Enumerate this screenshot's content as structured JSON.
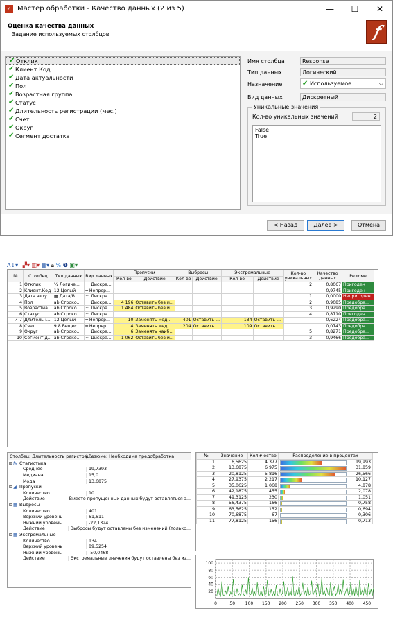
{
  "dialog": {
    "title": "Мастер обработки - Качество данных (2 из 5)",
    "heading": "Оценка качества данных",
    "subheading": "Задание используемых столбцов",
    "win_min": "—",
    "win_max": "☐",
    "win_close": "✕"
  },
  "columns": [
    "Отклик",
    "Клиент.Код",
    "Дата актуальности",
    "Пол",
    "Возрастная группа",
    "Статус",
    "Длительность регистрации (мес.)",
    "Счет",
    "Округ",
    "Сегмент достатка"
  ],
  "props": {
    "name_label": "Имя столбца",
    "name": "Response",
    "type_label": "Тип данных",
    "type": "Логический",
    "usage_label": "Назначение",
    "usage": "Используемое",
    "kind_label": "Вид данных",
    "kind": "Дискретный",
    "group_label": "Уникальные значения",
    "count_label": "Кол-во уникальных значений",
    "count": "2",
    "values": [
      "False",
      "True"
    ]
  },
  "buttons": {
    "back": "< Назад",
    "next": "Далее >",
    "cancel": "Отмена"
  },
  "grid": {
    "headers": {
      "num": "№",
      "col": "Столбец",
      "type": "Тип данных",
      "kind": "Вид данных",
      "gaps": "Пропуски",
      "outliers": "Выбросы",
      "extremes": "Экстремальные",
      "count": "Кол-во",
      "action": "Действие",
      "unique": "Кол-во уникальных",
      "quality": "Качество данных",
      "resume": "Резюме"
    },
    "rows": [
      [
        "1",
        "Отклик",
        "⁰⁄₁ Логиче...",
        "··· Дискре...",
        "",
        "",
        "",
        "",
        "",
        "",
        "2",
        "0,8067",
        "Пригоден",
        "ok"
      ],
      [
        "2",
        "Клиент.Код",
        "12 Целый",
        "━ Непрер...",
        "",
        "",
        "",
        "",
        "",
        "",
        "",
        "0,9745",
        "Пригоден",
        "ok"
      ],
      [
        "3",
        "Дата акту...",
        "▦ Дата/В...",
        "··· Дискре...",
        "",
        "",
        "",
        "",
        "",
        "",
        "1",
        "0,0000",
        "Непригоден",
        "bad"
      ],
      [
        "4",
        "Пол",
        "ab Строко...",
        "··· Дискре...",
        "4 196",
        "Оставить без и...",
        "",
        "",
        "",
        "",
        "2",
        "0,9085",
        "Предобра...",
        "pre"
      ],
      [
        "5",
        "Возрастна...",
        "ab Строко...",
        "··· Дискре...",
        "1 484",
        "Оставить без и...",
        "",
        "",
        "",
        "",
        "3",
        "0,9290",
        "Предобра...",
        "pre"
      ],
      [
        "6",
        "Статус",
        "ab Строко...",
        "··· Дискре...",
        "",
        "",
        "",
        "",
        "",
        "",
        "4",
        "0,8710",
        "Пригоден",
        "ok"
      ],
      [
        "7",
        "Длительн...",
        "12 Целый",
        "━ Непрер...",
        "10",
        "Заменять мед...",
        "401",
        "Оставить ...",
        "134",
        "Оставить ...",
        "",
        "0,6224",
        "Предобра...",
        "pre"
      ],
      [
        "8",
        "Счет",
        "9.8 Вещест...",
        "━ Непрер...",
        "4",
        "Заменять мед...",
        "204",
        "Оставить ...",
        "109",
        "Оставить ...",
        "",
        "0,0743",
        "Предобра...",
        "pre"
      ],
      [
        "9",
        "Округ",
        "ab Строко...",
        "··· Дискре...",
        "6",
        "Заменять наиб...",
        "",
        "",
        "",
        "",
        "5",
        "0,8271",
        "Предобра...",
        "pre"
      ],
      [
        "10",
        "Сегмент д...",
        "ab Строко...",
        "··· Дискре...",
        "1 062",
        "Оставить без и...",
        "",
        "",
        "",
        "",
        "3",
        "0,9466",
        "Предобра...",
        "pre"
      ]
    ]
  },
  "stats": {
    "col_header": "Столбец: Длительность регистрац...",
    "resume_header": "Резюме: Необходима предобработка",
    "rows": [
      [
        "g",
        "fx",
        "Статистика",
        ""
      ],
      [
        "i",
        "",
        "Среднее",
        "19,7393"
      ],
      [
        "i",
        "",
        "Медиана",
        "15,0"
      ],
      [
        "i",
        "",
        "Мода",
        "13,6875"
      ],
      [
        "g",
        "◢",
        "Пропуски",
        ""
      ],
      [
        "i",
        "",
        "Количество",
        "10"
      ],
      [
        "i",
        "",
        "Действие",
        "Вместо пропущенных данных будут вставляться з..."
      ],
      [
        "g",
        "▦",
        "Выбросы",
        ""
      ],
      [
        "i",
        "",
        "Количество",
        "401"
      ],
      [
        "i",
        "",
        "Верхний уровень",
        "61,611"
      ],
      [
        "i",
        "",
        "Нижний уровень",
        "-22,1324"
      ],
      [
        "i",
        "",
        "Действие",
        "Выбросы будут оставлены без изменений (только..."
      ],
      [
        "g",
        "▦",
        "Экстремальные",
        ""
      ],
      [
        "i",
        "",
        "Количество",
        "134"
      ],
      [
        "i",
        "",
        "Верхний уровень",
        "89,5254"
      ],
      [
        "i",
        "",
        "Нижний уровень",
        "-50,0468"
      ],
      [
        "i",
        "",
        "Действие",
        "Экстремальные значения будут оставлены без из..."
      ]
    ]
  },
  "dist": {
    "headers": [
      "№",
      "Значение",
      "Количество",
      "Распределение в процентах"
    ],
    "rows": [
      [
        "1",
        "6,5625",
        "4 377",
        "19,993",
        19.993
      ],
      [
        "2",
        "13,6875",
        "6 975",
        "31,859",
        31.859
      ],
      [
        "3",
        "20,8125",
        "5 816",
        "26,566",
        26.566
      ],
      [
        "4",
        "27,9375",
        "2 217",
        "10,127",
        10.127
      ],
      [
        "5",
        "35,0625",
        "1 068",
        "4,878",
        4.878
      ],
      [
        "6",
        "42,1875",
        "455",
        "2,078",
        2.078
      ],
      [
        "7",
        "49,3125",
        "230",
        "1,051",
        1.051
      ],
      [
        "8",
        "56,4375",
        "166",
        "0,758",
        0.758
      ],
      [
        "9",
        "63,5625",
        "152",
        "0,694",
        0.694
      ],
      [
        "10",
        "70,6875",
        "67",
        "0,306",
        0.306
      ],
      [
        "11",
        "77,8125",
        "156",
        "0,713",
        0.713
      ]
    ]
  },
  "chart_data": {
    "type": "line",
    "title": "",
    "xlabel": "",
    "ylabel": "",
    "xlim": [
      0,
      470
    ],
    "ylim": [
      0,
      110
    ],
    "x_ticks": [
      "0",
      "50",
      "100",
      "150",
      "200",
      "250",
      "300",
      "350",
      "400",
      "450"
    ],
    "y_ticks": [
      "20",
      "40",
      "60",
      "80",
      "100"
    ],
    "series": [
      {
        "values": [
          5,
          8,
          30,
          12,
          6,
          48,
          10,
          7,
          22,
          9,
          35,
          6,
          18,
          8,
          55,
          10,
          7,
          28,
          9,
          14,
          6,
          40,
          11,
          8,
          25,
          7,
          60,
          9,
          12,
          30,
          8,
          18,
          6,
          45,
          10,
          9,
          22,
          7,
          35,
          8,
          14,
          52,
          9,
          11,
          26,
          7,
          19,
          8,
          38,
          10,
          6,
          28,
          9,
          16,
          48,
          7,
          12,
          31,
          8,
          20,
          9,
          62,
          10,
          7,
          24,
          11,
          36,
          8,
          15,
          44,
          9,
          21,
          7,
          33,
          10,
          13,
          50,
          8,
          18,
          27,
          9,
          42,
          7,
          14,
          58,
          10,
          23,
          8,
          30,
          12,
          9,
          46,
          7,
          19,
          35,
          8,
          16,
          40,
          11,
          25,
          9,
          54,
          8,
          20,
          32,
          10,
          14,
          47,
          9,
          28,
          8,
          38,
          12,
          6,
          52,
          10,
          22,
          9,
          34,
          14,
          7,
          43,
          11,
          26,
          8,
          30
        ],
        "color": "#2e9d2e"
      }
    ]
  }
}
